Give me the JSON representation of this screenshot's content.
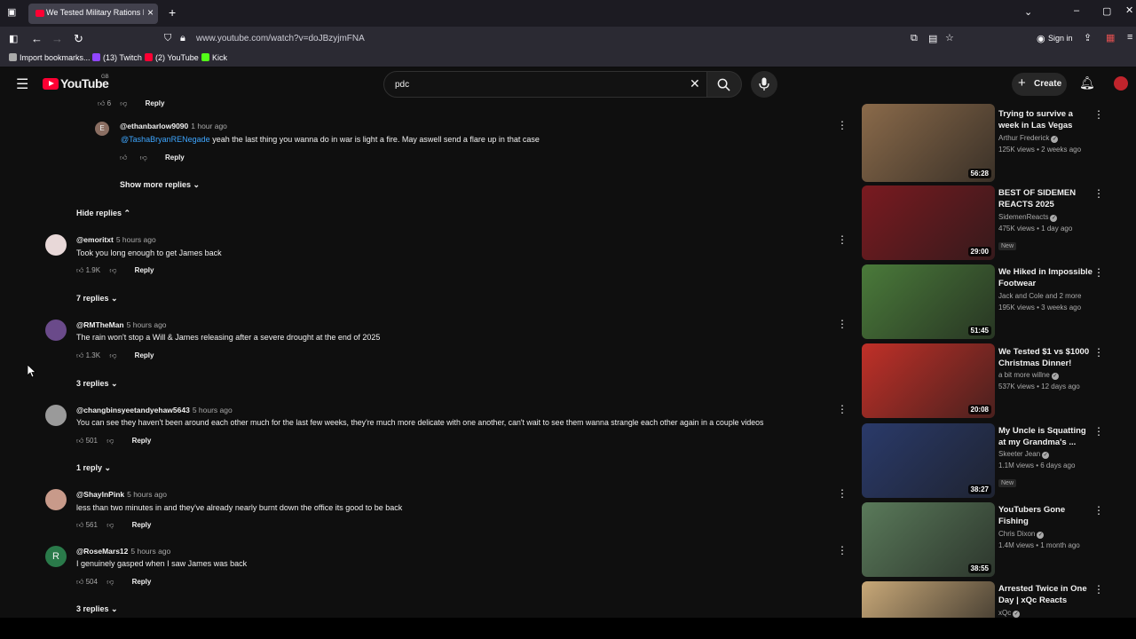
{
  "browser": {
    "tab_title": "We Tested Military Rations From",
    "url": "www.youtube.com/watch?v=doJBzyjmFNA",
    "signin": "Sign in",
    "bookmarks": [
      {
        "label": "Import bookmarks...",
        "color": "#aaaaaa"
      },
      {
        "label": "(13) Twitch",
        "color": "#9146ff"
      },
      {
        "label": "(2) YouTube",
        "color": "#ff0033"
      },
      {
        "label": "Kick",
        "color": "#53fc18"
      }
    ]
  },
  "yt": {
    "logo": "YouTube",
    "region": "GB",
    "search_value": "pdc",
    "create": "Create"
  },
  "comments": {
    "reply_ethan": {
      "author": "@ethanbarlow9090",
      "time": "1 hour ago",
      "mention": "@TashaBryanRENegade",
      "text": " yeah the last thing you wanna do in war is light a fire. May aswell send a flare up in that case",
      "reply": "Reply",
      "avatar_letter": "E"
    },
    "top_partial": {
      "likes": "6",
      "reply": "Reply"
    },
    "show_more": "Show more replies",
    "hide_replies": "Hide replies",
    "items": [
      {
        "author": "@emoritxt",
        "time": "5 hours ago",
        "text": "Took you long enough to get James back",
        "likes": "1.9K",
        "reply": "Reply",
        "replies": "7 replies"
      },
      {
        "author": "@RMTheMan",
        "time": "5 hours ago",
        "text": "The rain won't stop a Will & James releasing after a severe drought at the end of 2025",
        "likes": "1.3K",
        "reply": "Reply",
        "replies": "3 replies"
      },
      {
        "author": "@changbinsyeetandyehaw5643",
        "time": "5 hours ago",
        "text": "You can see they haven't been around each other much for the last few weeks, they're much more delicate with one another, can't wait to see them wanna strangle each other again in a couple videos",
        "likes": "501",
        "reply": "Reply",
        "replies": "1 reply"
      },
      {
        "author": "@ShaylnPink",
        "time": "5 hours ago",
        "text": "less than two minutes in and they've already nearly burnt down the office its good to be back",
        "likes": "561",
        "reply": "Reply",
        "replies": ""
      },
      {
        "author": "@RoseMars12",
        "time": "5 hours ago",
        "text": "I genuinely gasped when I saw James was back",
        "likes": "504",
        "reply": "Reply",
        "replies": "3 replies",
        "avatar_letter": "R"
      }
    ]
  },
  "sidebar": {
    "videos": [
      {
        "title": "Trying to survive a week in Las Vegas",
        "channel": "Arthur Frederick",
        "verified": true,
        "meta": "125K views • 2 weeks ago",
        "duration": "56:28",
        "badge": "",
        "thumb_color": "#8a6a4a"
      },
      {
        "title": "BEST OF SIDEMEN REACTS 2025",
        "channel": "SidemenReacts",
        "verified": true,
        "meta": "475K views • 1 day ago",
        "duration": "29:00",
        "badge": "New",
        "thumb_color": "#7a1a20"
      },
      {
        "title": "We Hiked in Impossible Footwear",
        "channel": "Jack and Cole and 2 more",
        "verified": false,
        "meta": "195K views • 3 weeks ago",
        "duration": "51:45",
        "badge": "",
        "thumb_color": "#4a7a3a"
      },
      {
        "title": "We Tested $1 vs $1000 Christmas Dinner!",
        "channel": "a bit more willne",
        "verified": true,
        "meta": "537K views • 12 days ago",
        "duration": "20:08",
        "badge": "",
        "thumb_color": "#c03028"
      },
      {
        "title": "My Uncle is Squatting at my Grandma's ...",
        "channel": "Skeeter Jean",
        "verified": true,
        "meta": "1.1M views • 6 days ago",
        "duration": "38:27",
        "badge": "New",
        "thumb_color": "#2a3a6a"
      },
      {
        "title": "YouTubers Gone Fishing",
        "channel": "Chris Dixon",
        "verified": true,
        "meta": "1.4M views • 1 month ago",
        "duration": "38:55",
        "badge": "",
        "thumb_color": "#5a7a5a"
      },
      {
        "title": "Arrested Twice in One Day | xQc Reacts",
        "channel": "xQc",
        "verified": true,
        "meta": "",
        "duration": "",
        "badge": "",
        "thumb_color": "#c8a878"
      }
    ]
  }
}
